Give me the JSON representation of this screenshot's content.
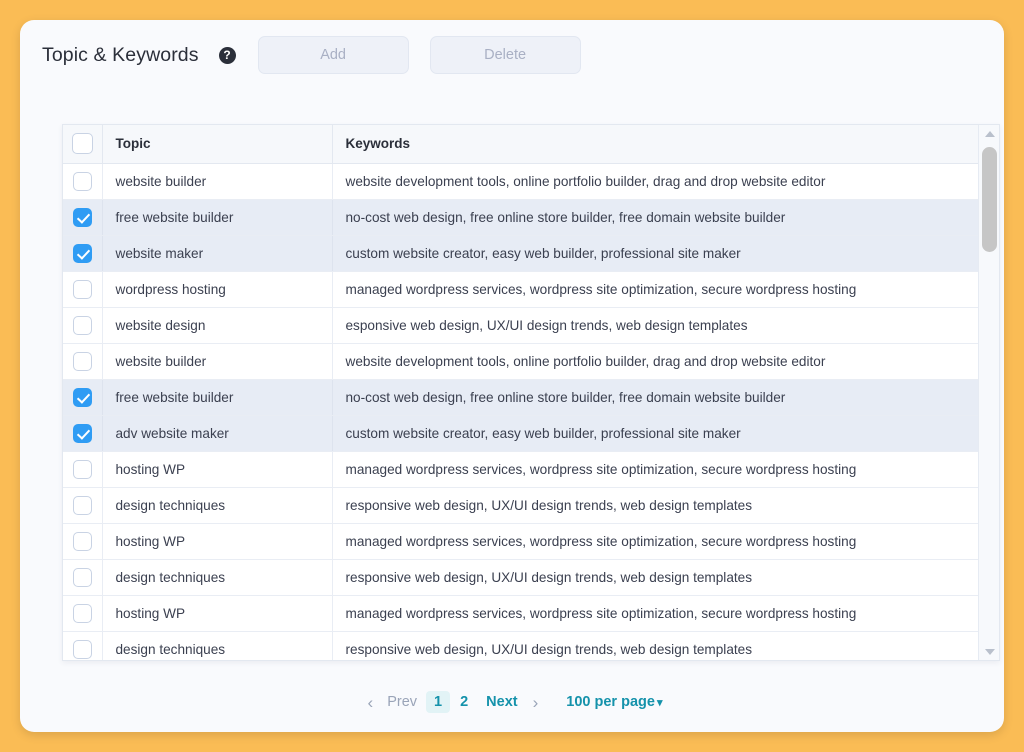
{
  "header": {
    "title": "Topic & Keywords",
    "help_icon": "question-mark-icon",
    "add_label": "Add",
    "delete_label": "Delete"
  },
  "table": {
    "columns": [
      "",
      "Topic",
      "Keywords"
    ],
    "header_checkbox_checked": false,
    "rows": [
      {
        "checked": false,
        "topic": "website builder",
        "keywords": "website development tools, online portfolio builder, drag and drop website editor"
      },
      {
        "checked": true,
        "topic": "free website builder",
        "keywords": "no-cost web design, free online store builder, free domain website builder"
      },
      {
        "checked": true,
        "topic": "website maker",
        "keywords": "custom website creator, easy web builder, professional site maker"
      },
      {
        "checked": false,
        "topic": "wordpress hosting",
        "keywords": "managed wordpress services, wordpress site optimization, secure wordpress hosting"
      },
      {
        "checked": false,
        "topic": "website design",
        "keywords": "esponsive web design, UX/UI design trends, web design templates"
      },
      {
        "checked": false,
        "topic": "website builder",
        "keywords": "website development tools, online portfolio builder, drag and drop website editor"
      },
      {
        "checked": true,
        "topic": "free website builder",
        "keywords": "no-cost web design, free online store builder, free domain website builder"
      },
      {
        "checked": true,
        "topic": "adv website maker",
        "keywords": "custom website creator, easy web builder, professional site maker"
      },
      {
        "checked": false,
        "topic": "hosting WP",
        "keywords": "managed wordpress services, wordpress site optimization, secure wordpress hosting"
      },
      {
        "checked": false,
        "topic": "design techniques",
        "keywords": "responsive web design, UX/UI design trends, web design templates"
      },
      {
        "checked": false,
        "topic": "hosting WP",
        "keywords": "managed wordpress services, wordpress site optimization, secure wordpress hosting"
      },
      {
        "checked": false,
        "topic": "design techniques",
        "keywords": "responsive web design, UX/UI design trends, web design templates"
      },
      {
        "checked": false,
        "topic": "hosting WP",
        "keywords": "managed wordpress services, wordpress site optimization, secure wordpress hosting"
      },
      {
        "checked": false,
        "topic": "design techniques",
        "keywords": "responsive web design, UX/UI design trends, web design templates"
      }
    ]
  },
  "scrollbar": {
    "up_icon": "triangle-up-icon",
    "down_icon": "triangle-down-icon"
  },
  "pagination": {
    "prev_chevron": "‹",
    "prev_label": "Prev",
    "pages": [
      "1",
      "2"
    ],
    "active_page": "1",
    "next_label": "Next",
    "next_chevron": "›",
    "per_page_label": "100 per page",
    "per_page_caret": "▾"
  },
  "colors": {
    "page_background": "#fabc55",
    "card_background": "#f9fafd",
    "checkbox_checked": "#2f9cf4",
    "selected_row": "#e7ecf5",
    "link_accent": "#1592ab",
    "muted_text": "#9aa4b8"
  }
}
